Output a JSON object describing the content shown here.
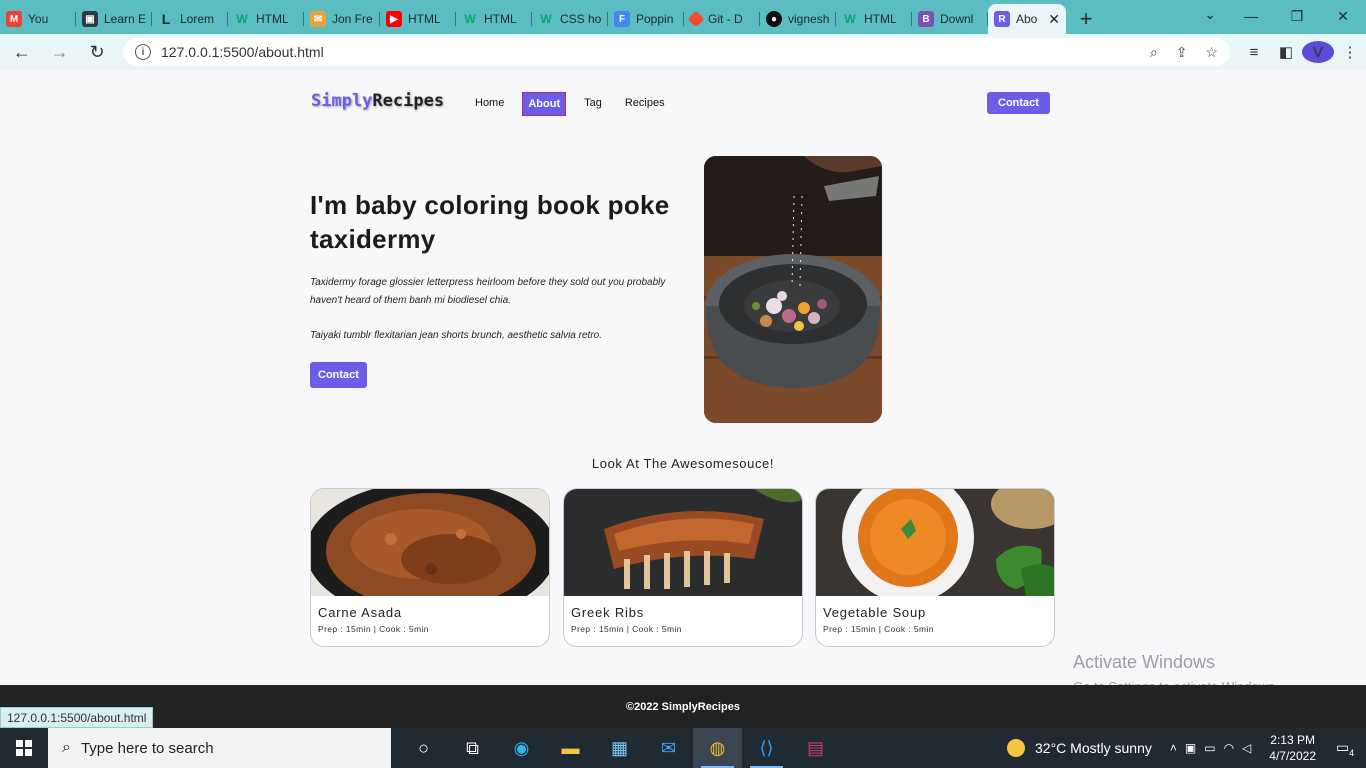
{
  "browser": {
    "tabs": [
      {
        "label": "You",
        "icon": "gmail-icon",
        "color": "#ea4335"
      },
      {
        "label": "Learn E",
        "icon": "learn-icon",
        "color": "#2f3b44"
      },
      {
        "label": "Lorem",
        "icon": "lorem-icon",
        "color": "#1d2b2c"
      },
      {
        "label": "HTML",
        "icon": "w3-icon",
        "color": "#04aa6d"
      },
      {
        "label": "Jon Fre",
        "icon": "mail-icon",
        "color": "#e8a33c"
      },
      {
        "label": "HTML",
        "icon": "youtube-icon",
        "color": "#ff0000"
      },
      {
        "label": "HTML",
        "icon": "w3-icon",
        "color": "#04aa6d"
      },
      {
        "label": "CSS ho",
        "icon": "w3-icon",
        "color": "#04aa6d"
      },
      {
        "label": "Poppin",
        "icon": "google-fonts-icon",
        "color": "#4285f4"
      },
      {
        "label": "Git - D",
        "icon": "git-icon",
        "color": "#f05032"
      },
      {
        "label": "vignesh",
        "icon": "github-icon",
        "color": "#111111"
      },
      {
        "label": "HTML",
        "icon": "w3-icon",
        "color": "#04aa6d"
      },
      {
        "label": "Downl",
        "icon": "bootstrap-icon",
        "color": "#7952b3"
      },
      {
        "label": "Abo",
        "icon": "recipes-icon",
        "color": "#6c5ce7"
      }
    ],
    "url": "127.0.0.1:5500/about.html",
    "profile_initial": "V"
  },
  "site": {
    "logo_part1": "Simply",
    "logo_part2": "Recipes",
    "nav": {
      "home": "Home",
      "about": "About",
      "tag": "Tag",
      "recipes": "Recipes",
      "contact": "Contact"
    },
    "hero": {
      "title": "I'm baby coloring book poke taxidermy",
      "paragraph1": "Taxidermy forage glossier letterpress heirloom before they sold out you probably haven't heard of them banh mi biodiesel chia.",
      "paragraph2": "Taiyaki tumblr flexitarian jean shorts brunch, aesthetic salvia retro.",
      "button": "Contact"
    },
    "section_title": "Look At The Awesomesouce!",
    "cards": [
      {
        "title": "Carne Asada",
        "meta": "Prep : 15min | Cook : 5min"
      },
      {
        "title": "Greek Ribs",
        "meta": "Prep : 15min | Cook : 5min"
      },
      {
        "title": "Vegetable Soup",
        "meta": "Prep : 15min | Cook : 5min"
      }
    ],
    "footer": "©2022 SimplyRecipes"
  },
  "watermark": {
    "line1": "Activate Windows",
    "line2": "Go to Settings to activate Windows."
  },
  "status_url": "127.0.0.1:5500/about.html",
  "taskbar": {
    "search_placeholder": "Type here to search",
    "weather": "32°C  Mostly sunny",
    "time": "2:13 PM",
    "date": "4/7/2022",
    "notifications": "4"
  },
  "colors": {
    "accent": "#6c5ce7",
    "tabstrip": "#5bbdc1",
    "footer": "#222222"
  }
}
